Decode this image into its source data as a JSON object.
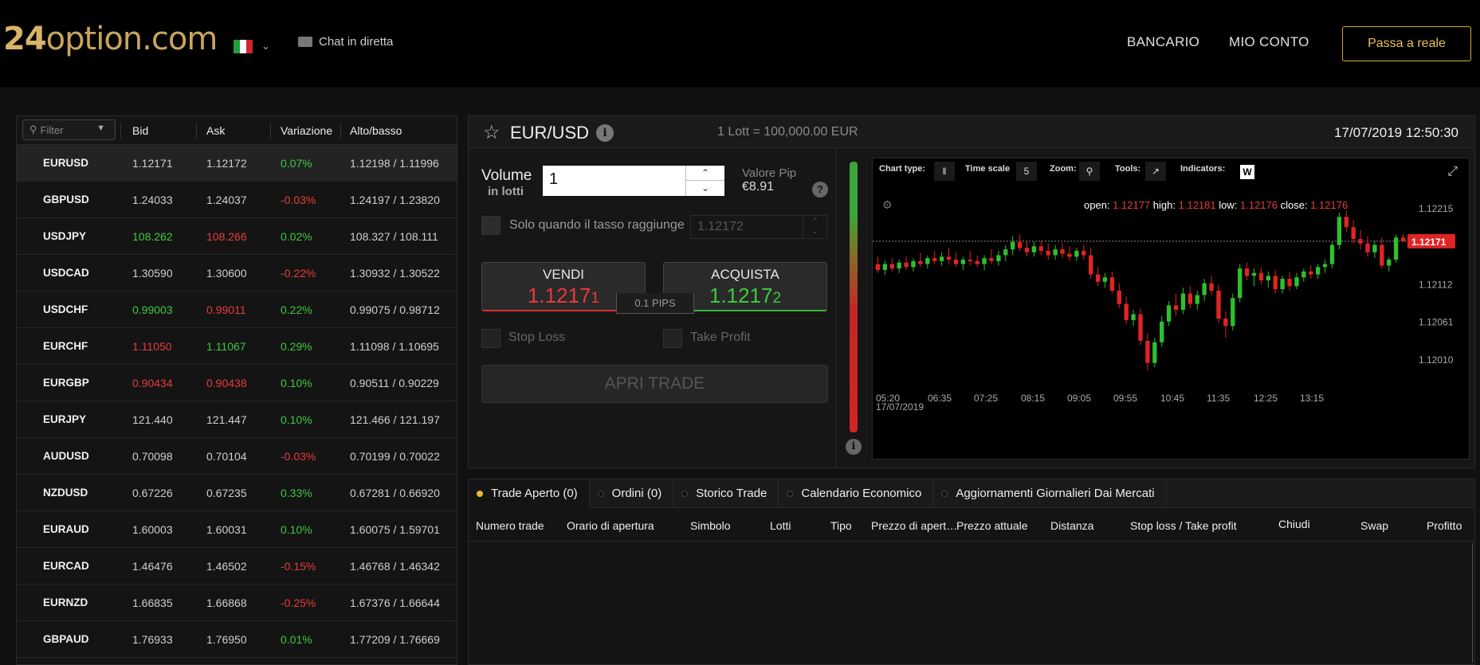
{
  "header": {
    "logo_num": "24",
    "logo_text": "option.com",
    "chat_label": "Chat in diretta",
    "nav_banking": "BANCARIO",
    "nav_account": "MIO CONTO",
    "cta": "Passa a reale"
  },
  "markets": {
    "filter_placeholder": "Filter",
    "cols": [
      "Bid",
      "Ask",
      "Variazione",
      "Alto/basso"
    ],
    "rows": [
      {
        "symbol": "EURUSD",
        "bid": "1.12171",
        "ask": "1.12172",
        "change": "0.07%",
        "range": "1.12198 / 1.11996",
        "bid_color": "",
        "ask_color": "",
        "chg": "g"
      },
      {
        "symbol": "GBPUSD",
        "bid": "1.24033",
        "ask": "1.24037",
        "change": "-0.03%",
        "range": "1.24197 / 1.23820",
        "bid_color": "",
        "ask_color": "",
        "chg": "r"
      },
      {
        "symbol": "USDJPY",
        "bid": "108.262",
        "ask": "108.266",
        "change": "0.02%",
        "range": "108.327 / 108.111",
        "bid_color": "g",
        "ask_color": "r",
        "chg": "g"
      },
      {
        "symbol": "USDCAD",
        "bid": "1.30590",
        "ask": "1.30600",
        "change": "-0.22%",
        "range": "1.30932 / 1.30522",
        "bid_color": "",
        "ask_color": "",
        "chg": "r"
      },
      {
        "symbol": "USDCHF",
        "bid": "0.99003",
        "ask": "0.99011",
        "change": "0.22%",
        "range": "0.99075 / 0.98712",
        "bid_color": "g",
        "ask_color": "r",
        "chg": "g"
      },
      {
        "symbol": "EURCHF",
        "bid": "1.11050",
        "ask": "1.11067",
        "change": "0.29%",
        "range": "1.11098 / 1.10695",
        "bid_color": "r",
        "ask_color": "g",
        "chg": "g"
      },
      {
        "symbol": "EURGBP",
        "bid": "0.90434",
        "ask": "0.90438",
        "change": "0.10%",
        "range": "0.90511 / 0.90229",
        "bid_color": "r",
        "ask_color": "r",
        "chg": "g"
      },
      {
        "symbol": "EURJPY",
        "bid": "121.440",
        "ask": "121.447",
        "change": "0.10%",
        "range": "121.466 / 121.197",
        "bid_color": "",
        "ask_color": "",
        "chg": "g"
      },
      {
        "symbol": "AUDUSD",
        "bid": "0.70098",
        "ask": "0.70104",
        "change": "-0.03%",
        "range": "0.70199 / 0.70022",
        "bid_color": "",
        "ask_color": "",
        "chg": "r"
      },
      {
        "symbol": "NZDUSD",
        "bid": "0.67226",
        "ask": "0.67235",
        "change": "0.33%",
        "range": "0.67281 / 0.66920",
        "bid_color": "",
        "ask_color": "",
        "chg": "g"
      },
      {
        "symbol": "EURAUD",
        "bid": "1.60003",
        "ask": "1.60031",
        "change": "0.10%",
        "range": "1.60075 / 1.59701",
        "bid_color": "",
        "ask_color": "",
        "chg": "g"
      },
      {
        "symbol": "EURCAD",
        "bid": "1.46476",
        "ask": "1.46502",
        "change": "-0.15%",
        "range": "1.46768 / 1.46342",
        "bid_color": "",
        "ask_color": "",
        "chg": "r"
      },
      {
        "symbol": "EURNZD",
        "bid": "1.66835",
        "ask": "1.66868",
        "change": "-0.25%",
        "range": "1.67376 / 1.66644",
        "bid_color": "",
        "ask_color": "",
        "chg": "r"
      },
      {
        "symbol": "GBPAUD",
        "bid": "1.76933",
        "ask": "1.76950",
        "change": "0.01%",
        "range": "1.77209 / 1.76669",
        "bid_color": "",
        "ask_color": "",
        "chg": "g"
      }
    ]
  },
  "trade": {
    "pair": "EUR/USD",
    "lot_info": "1 Lott = 100,000.00 EUR",
    "datetime": "17/07/2019 12:50:30",
    "volume_label": "Volume",
    "volume_sub": "in lotti",
    "volume_value": "1",
    "pip_label": "Valore Pip",
    "pip_value": "€8.91",
    "rate_condition": "Solo quando il tasso raggiunge",
    "rate_value": "1.12172",
    "sell_label": "VENDI",
    "sell_price": "1.1217",
    "sell_price_small": "1",
    "buy_label": "ACQUISTA",
    "buy_price": "1.1217",
    "buy_price_small": "2",
    "spread": "0.1 PIPS",
    "stop_loss": "Stop Loss",
    "take_profit": "Take Profit",
    "open_trade": "APRI TRADE"
  },
  "chart_toolbar": {
    "chart_type": "Chart type:",
    "time_scale": "Time scale",
    "time_scale_value": "5",
    "zoom": "Zoom:",
    "tools": "Tools:",
    "indicators": "Indicators:",
    "indicator_badge": "W"
  },
  "chart_data": {
    "type": "candlestick",
    "ohlc_labels": {
      "open": "open:",
      "high": "high:",
      "low": "low:",
      "close": "close:"
    },
    "ohlc_values": {
      "open": "1.12177",
      "high": "1.12181",
      "low": "1.12176",
      "close": "1.12176"
    },
    "y_ticks": [
      "1.12215",
      "1.12112",
      "1.12061",
      "1.12010"
    ],
    "x_ticks": [
      "05:20",
      "06:35",
      "07:25",
      "08:15",
      "09:05",
      "09:55",
      "10:45",
      "11:35",
      "12:25",
      "13:15"
    ],
    "x_date": "17/07/2019",
    "last_price": "1.12171",
    "colors": {
      "up": "#2fbf2f",
      "down": "#e02424"
    },
    "candles": [
      [
        1.1214,
        1.1215,
        1.12128,
        1.12132
      ],
      [
        1.12132,
        1.12145,
        1.12125,
        1.1214
      ],
      [
        1.1214,
        1.12148,
        1.1213,
        1.12134
      ],
      [
        1.12134,
        1.12146,
        1.12128,
        1.12142
      ],
      [
        1.12142,
        1.1215,
        1.12132,
        1.12136
      ],
      [
        1.12136,
        1.12148,
        1.1213,
        1.12144
      ],
      [
        1.12144,
        1.12155,
        1.12136,
        1.1214
      ],
      [
        1.1214,
        1.12152,
        1.12134,
        1.12148
      ],
      [
        1.12148,
        1.12158,
        1.1214,
        1.12144
      ],
      [
        1.12144,
        1.12156,
        1.12138,
        1.1215
      ],
      [
        1.1215,
        1.12162,
        1.1214,
        1.12146
      ],
      [
        1.12146,
        1.12156,
        1.12136,
        1.1214
      ],
      [
        1.1214,
        1.1215,
        1.12132,
        1.12146
      ],
      [
        1.12146,
        1.12158,
        1.12138,
        1.12144
      ],
      [
        1.12144,
        1.12152,
        1.12136,
        1.1214
      ],
      [
        1.1214,
        1.12152,
        1.12132,
        1.12148
      ],
      [
        1.12148,
        1.1216,
        1.1214,
        1.12144
      ],
      [
        1.12144,
        1.12158,
        1.12138,
        1.12152
      ],
      [
        1.12152,
        1.12166,
        1.12144,
        1.1216
      ],
      [
        1.1216,
        1.12178,
        1.12152,
        1.1217
      ],
      [
        1.1217,
        1.1218,
        1.12158,
        1.12162
      ],
      [
        1.12162,
        1.12172,
        1.1215,
        1.12156
      ],
      [
        1.12156,
        1.1217,
        1.1215,
        1.12164
      ],
      [
        1.12164,
        1.12172,
        1.12152,
        1.12158
      ],
      [
        1.12158,
        1.12168,
        1.12146,
        1.12152
      ],
      [
        1.12152,
        1.12166,
        1.12146,
        1.1216
      ],
      [
        1.1216,
        1.12168,
        1.12148,
        1.12154
      ],
      [
        1.12154,
        1.12164,
        1.12144,
        1.1215
      ],
      [
        1.1215,
        1.12162,
        1.12144,
        1.12158
      ],
      [
        1.12158,
        1.12166,
        1.12146,
        1.12152
      ],
      [
        1.12152,
        1.12162,
        1.1212,
        1.12126
      ],
      [
        1.12126,
        1.12136,
        1.1211,
        1.12116
      ],
      [
        1.12116,
        1.12128,
        1.12108,
        1.12122
      ],
      [
        1.12122,
        1.1213,
        1.121,
        1.12104
      ],
      [
        1.12104,
        1.12114,
        1.1208,
        1.12086
      ],
      [
        1.12086,
        1.12096,
        1.12058,
        1.12064
      ],
      [
        1.12064,
        1.12078,
        1.12056,
        1.12072
      ],
      [
        1.12072,
        1.1208,
        1.1203,
        1.12036
      ],
      [
        1.12036,
        1.12046,
        1.11996,
        1.12006
      ],
      [
        1.12006,
        1.1204,
        1.12,
        1.12034
      ],
      [
        1.12034,
        1.1207,
        1.12028,
        1.12062
      ],
      [
        1.12062,
        1.1209,
        1.12056,
        1.12084
      ],
      [
        1.12084,
        1.121,
        1.1207,
        1.12078
      ],
      [
        1.12078,
        1.12108,
        1.12072,
        1.121
      ],
      [
        1.121,
        1.1211,
        1.1208,
        1.12086
      ],
      [
        1.12086,
        1.12104,
        1.12078,
        1.12098
      ],
      [
        1.12098,
        1.1212,
        1.1209,
        1.12114
      ],
      [
        1.12114,
        1.12124,
        1.12098,
        1.12104
      ],
      [
        1.12104,
        1.12112,
        1.1206,
        1.12066
      ],
      [
        1.12066,
        1.12076,
        1.1204,
        1.12056
      ],
      [
        1.12056,
        1.121,
        1.1205,
        1.12094
      ],
      [
        1.12094,
        1.1214,
        1.12088,
        1.12134
      ],
      [
        1.12134,
        1.12142,
        1.12118,
        1.12124
      ],
      [
        1.12124,
        1.12134,
        1.1211,
        1.12128
      ],
      [
        1.12128,
        1.12136,
        1.12112,
        1.12118
      ],
      [
        1.12118,
        1.1213,
        1.12108,
        1.12124
      ],
      [
        1.12124,
        1.12132,
        1.121,
        1.12106
      ],
      [
        1.12106,
        1.12124,
        1.121,
        1.1212
      ],
      [
        1.1212,
        1.1213,
        1.12104,
        1.1211
      ],
      [
        1.1211,
        1.12128,
        1.12106,
        1.12122
      ],
      [
        1.12122,
        1.12134,
        1.12116,
        1.1213
      ],
      [
        1.1213,
        1.12138,
        1.1212,
        1.12126
      ],
      [
        1.12126,
        1.1214,
        1.1212,
        1.12136
      ],
      [
        1.12136,
        1.12146,
        1.12128,
        1.1214
      ],
      [
        1.1214,
        1.1217,
        1.12134,
        1.12166
      ],
      [
        1.12166,
        1.1221,
        1.1216,
        1.12204
      ],
      [
        1.12204,
        1.12212,
        1.12184,
        1.1219
      ],
      [
        1.1219,
        1.122,
        1.12168,
        1.12174
      ],
      [
        1.12174,
        1.12186,
        1.1216,
        1.12168
      ],
      [
        1.12168,
        1.12178,
        1.1215,
        1.12156
      ],
      [
        1.12156,
        1.12172,
        1.12148,
        1.12166
      ],
      [
        1.12166,
        1.12176,
        1.12134,
        1.12138
      ],
      [
        1.12138,
        1.1215,
        1.1213,
        1.12146
      ],
      [
        1.12146,
        1.1218,
        1.12142,
        1.12176
      ],
      [
        1.12176,
        1.12181,
        1.1217,
        1.12171
      ]
    ]
  },
  "positions": {
    "tabs": [
      "Trade Aperto (0)",
      "Ordini (0)",
      "Storico Trade",
      "Calendario Economico",
      "Aggiornamenti Giornalieri Dai Mercati"
    ],
    "cols": [
      "Numero trade",
      "Orario di apertura",
      "Simbolo",
      "Lotti",
      "Tipo",
      "Prezzo di apert…",
      "Prezzo attuale",
      "Distanza",
      "Stop loss / Take profit",
      "Chiudi",
      "Swap",
      "Profitto"
    ]
  }
}
